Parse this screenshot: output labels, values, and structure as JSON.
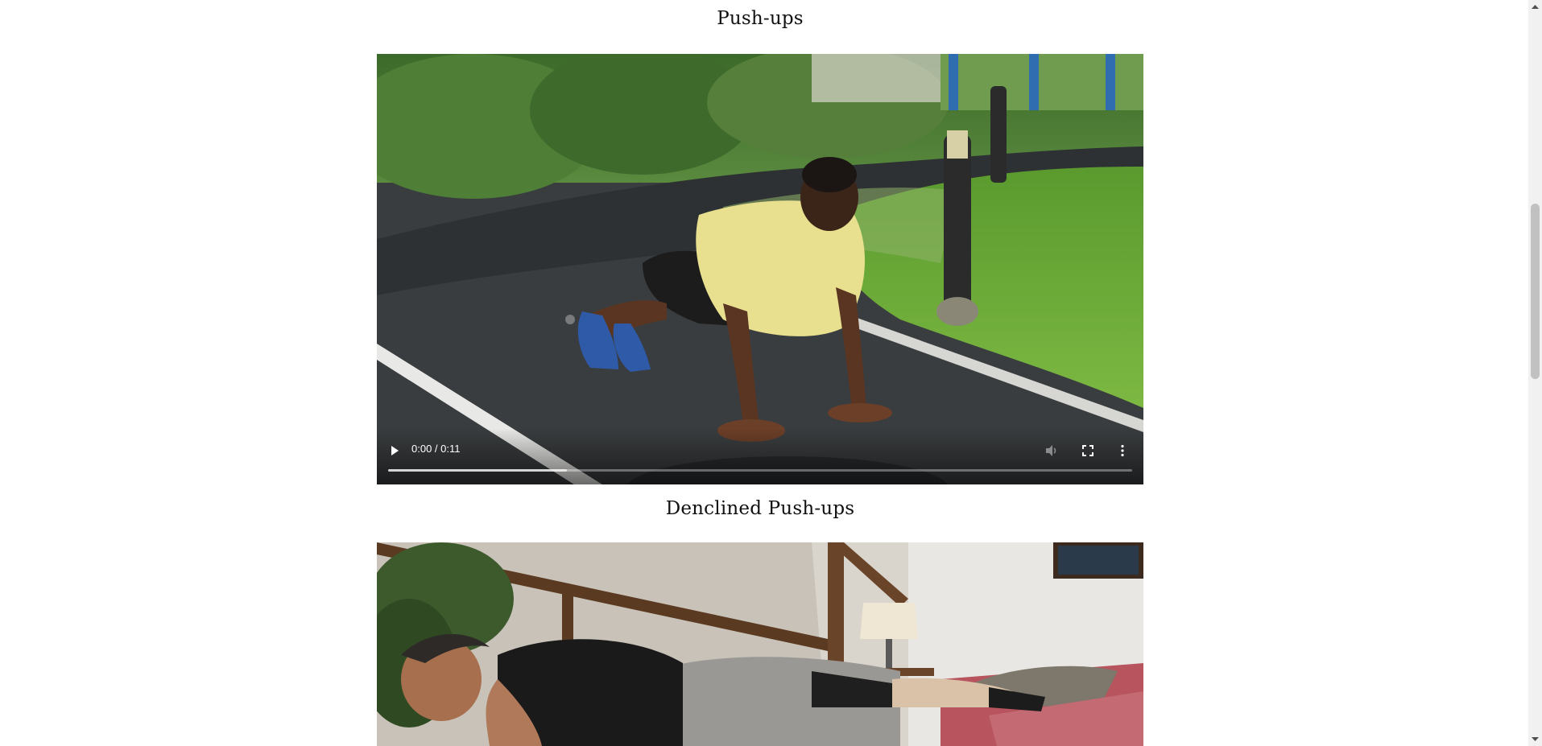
{
  "exercises": [
    {
      "title": "Push-ups",
      "video": {
        "current_time": "0:00",
        "duration": "0:11",
        "time_display": "0:00 / 0:11",
        "buffered_fraction": 0.24,
        "muted": true
      }
    },
    {
      "title": "Denclined Push-ups"
    }
  ],
  "icons": {
    "play": "play-icon",
    "volume": "volume-muted-icon",
    "fullscreen": "fullscreen-icon",
    "more": "more-vert-icon",
    "scroll_up": "chevron-up-icon",
    "scroll_down": "chevron-down-icon"
  },
  "colors": {
    "page_background": "#ffffff",
    "title_text": "#111111",
    "video_controls": "#ffffff",
    "scrollbar_track": "#f1f1f1",
    "scrollbar_thumb": "#c1c1c1"
  }
}
